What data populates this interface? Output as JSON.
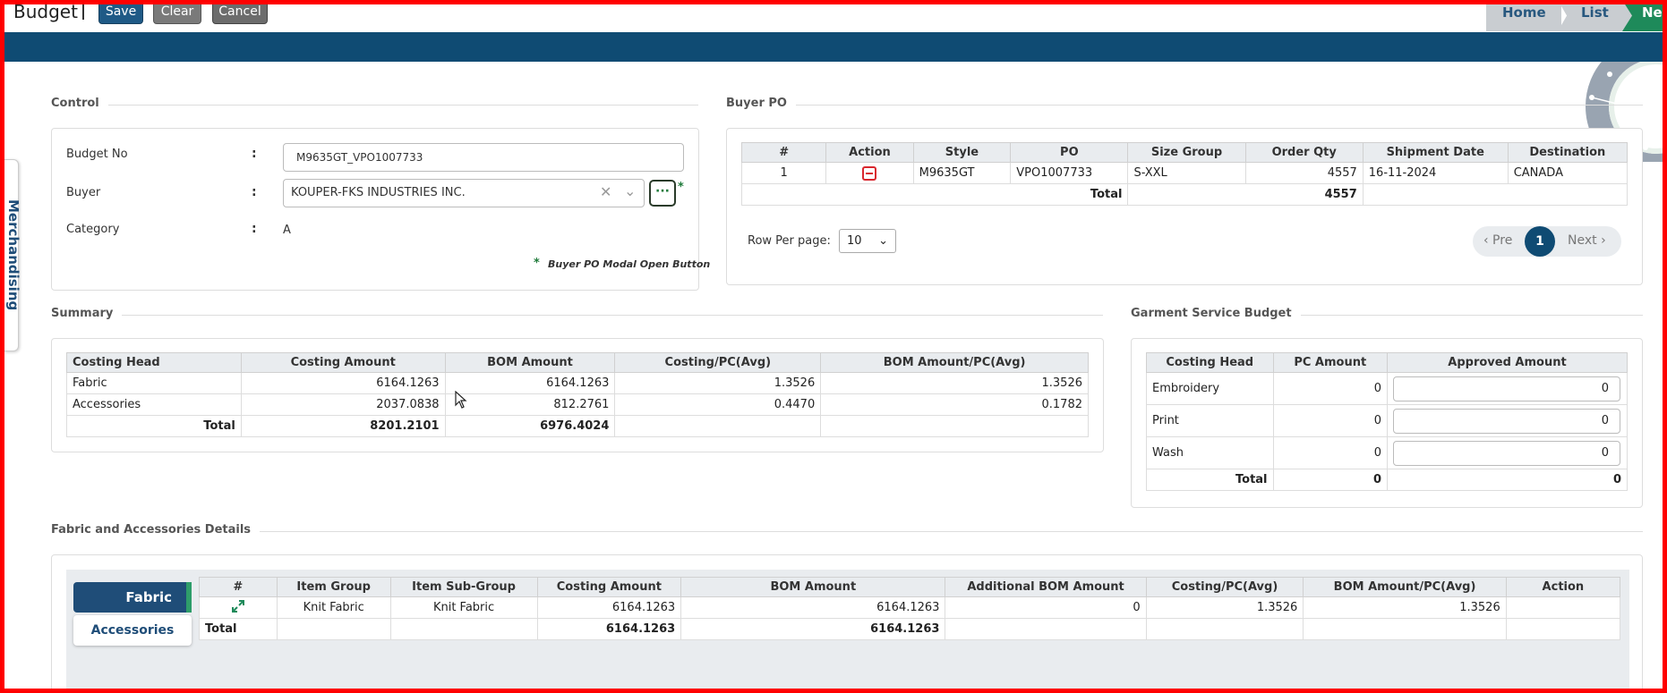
{
  "header": {
    "title": "Budget",
    "buttons": {
      "save": "Save",
      "clear": "Clear",
      "cancel": "Cancel"
    },
    "breadcrumb": {
      "home": "Home",
      "list": "List",
      "new": "New"
    }
  },
  "sidebar_tab": "Merchandising",
  "control": {
    "title": "Control",
    "budget_no_label": "Budget No",
    "budget_no_value": "M9635GT_VPO1007733",
    "buyer_label": "Buyer",
    "buyer_value": "KOUPER-FKS INDUSTRIES INC.",
    "category_label": "Category",
    "category_value": "A",
    "colon": ":",
    "dots": "···",
    "star": "*",
    "note": "Buyer PO Modal Open Button"
  },
  "buyer_po": {
    "title": "Buyer PO",
    "headers": [
      "#",
      "Action",
      "Style",
      "PO",
      "Size Group",
      "Order Qty",
      "Shipment Date",
      "Destination"
    ],
    "row": {
      "num": "1",
      "style": "M9635GT",
      "po": "VPO1007733",
      "size_group": "S-XXL",
      "order_qty": "4557",
      "shipment_date": "16-11-2024",
      "destination": "CANADA"
    },
    "total_label": "Total",
    "total_qty": "4557",
    "rows_per_page_label": "Row Per page:",
    "rows_per_page_value": "10",
    "pager": {
      "prev": "‹ Pre",
      "page": "1",
      "next": "Next ›"
    }
  },
  "summary": {
    "title": "Summary",
    "headers": [
      "Costing Head",
      "Costing Amount",
      "BOM Amount",
      "Costing/PC(Avg)",
      "BOM Amount/PC(Avg)"
    ],
    "rows": [
      {
        "head": "Fabric",
        "costing": "6164.1263",
        "bom": "6164.1263",
        "costing_pc": "1.3526",
        "bom_pc": "1.3526"
      },
      {
        "head": "Accessories",
        "costing": "2037.0838",
        "bom": "812.2761",
        "costing_pc": "0.4470",
        "bom_pc": "0.1782"
      }
    ],
    "total_label": "Total",
    "total_costing": "8201.2101",
    "total_bom": "6976.4024"
  },
  "garment_service": {
    "title": "Garment Service Budget",
    "headers": [
      "Costing Head",
      "PC Amount",
      "Approved Amount"
    ],
    "rows": [
      {
        "head": "Embroidery",
        "pc": "0",
        "approved": "0"
      },
      {
        "head": "Print",
        "pc": "0",
        "approved": "0"
      },
      {
        "head": "Wash",
        "pc": "0",
        "approved": "0"
      }
    ],
    "total_label": "Total",
    "total_pc": "0",
    "total_approved": "0"
  },
  "details": {
    "title": "Fabric and Accessories Details",
    "tabs": {
      "fabric": "Fabric",
      "accessories": "Accessories"
    },
    "headers": [
      "#",
      "Item Group",
      "Item Sub-Group",
      "Costing Amount",
      "BOM Amount",
      "Additional BOM Amount",
      "Costing/PC(Avg)",
      "BOM Amount/PC(Avg)",
      "Action"
    ],
    "row": {
      "group": "Knit Fabric",
      "sub_group": "Knit Fabric",
      "costing": "6164.1263",
      "bom": "6164.1263",
      "additional": "0",
      "costing_pc": "1.3526",
      "bom_pc": "1.3526"
    },
    "total_label": "Total",
    "total_costing": "6164.1263",
    "total_bom": "6164.1263"
  },
  "colors": {
    "primary": "#0f4b73",
    "accent_green": "#1e8a5a",
    "danger": "#d9272e"
  }
}
